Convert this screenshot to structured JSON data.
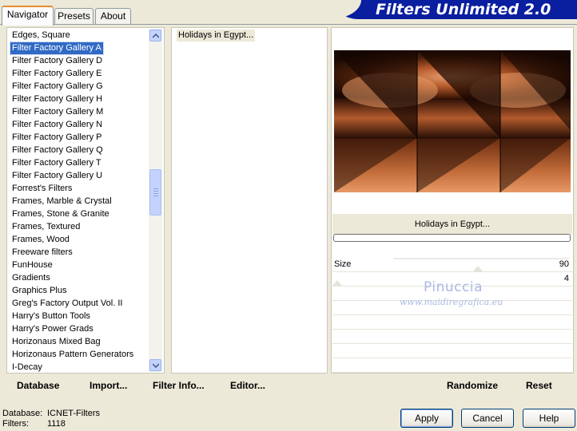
{
  "tabs": [
    {
      "label": "Navigator",
      "active": true
    },
    {
      "label": "Presets",
      "active": false
    },
    {
      "label": "About",
      "active": false
    }
  ],
  "banner": {
    "title": "Filters Unlimited 2.0"
  },
  "categories": {
    "items": [
      "Edges, Square",
      "Filter Factory Gallery A",
      "Filter Factory Gallery D",
      "Filter Factory Gallery E",
      "Filter Factory Gallery G",
      "Filter Factory Gallery H",
      "Filter Factory Gallery M",
      "Filter Factory Gallery N",
      "Filter Factory Gallery P",
      "Filter Factory Gallery Q",
      "Filter Factory Gallery T",
      "Filter Factory Gallery U",
      "Forrest's Filters",
      "Frames, Marble & Crystal",
      "Frames, Stone & Granite",
      "Frames, Textured",
      "Frames, Wood",
      "Freeware filters",
      "FunHouse",
      "Gradients",
      "Graphics Plus",
      "Greg's Factory Output Vol. II",
      "Harry's Button Tools",
      "Harry's Power Grads",
      "Horizonaus Mixed Bag",
      "Horizonaus Pattern Generators",
      "I-Decay"
    ],
    "selected": "Filter Factory Gallery A"
  },
  "filters": {
    "items": [
      "Holidays in Egypt..."
    ]
  },
  "preview": {
    "filter_name": "Holidays in Egypt..."
  },
  "params": [
    {
      "name": "Size",
      "value": "90"
    },
    {
      "name": "",
      "value": "4"
    }
  ],
  "watermark": {
    "line1": "Pinuccia",
    "line2": "www.maidiregrafica.eu"
  },
  "toolbar": {
    "database": "Database",
    "import": "Import...",
    "filter_info": "Filter Info...",
    "editor": "Editor...",
    "randomize": "Randomize",
    "reset": "Reset"
  },
  "status": {
    "database_label": "Database:",
    "database_value": "ICNET-Filters",
    "filters_label": "Filters:",
    "filters_value": "1118"
  },
  "buttons": {
    "apply": "Apply",
    "cancel": "Cancel",
    "help": "Help"
  },
  "colors": {
    "selection": "#316ac5",
    "banner": "#0a1ea0",
    "window_bg": "#ece9d8"
  }
}
